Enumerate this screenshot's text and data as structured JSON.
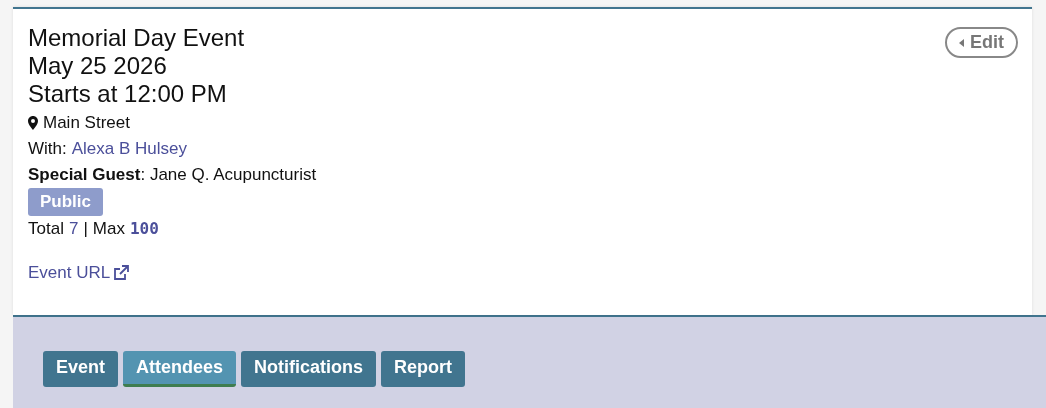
{
  "event": {
    "title": "Memorial Day Event",
    "date": "May 25 2026",
    "starts": "Starts at 12:00 PM",
    "location": "Main Street",
    "with_label": "With:",
    "host": "Alexa B Hulsey",
    "special_guest": "**Special Guest**: Jane Q. Acupuncturist",
    "visibility_badge": "Public",
    "total_label": "Total",
    "total_value": "7",
    "separator": "|",
    "max_label": "Max",
    "max_value": "100",
    "url_link": "Event URL"
  },
  "edit_button": {
    "label": "Edit"
  },
  "tabs": [
    {
      "label": "Event",
      "selected": false
    },
    {
      "label": "Attendees",
      "selected": true
    },
    {
      "label": "Notifications",
      "selected": false
    },
    {
      "label": "Report",
      "selected": false
    }
  ]
}
